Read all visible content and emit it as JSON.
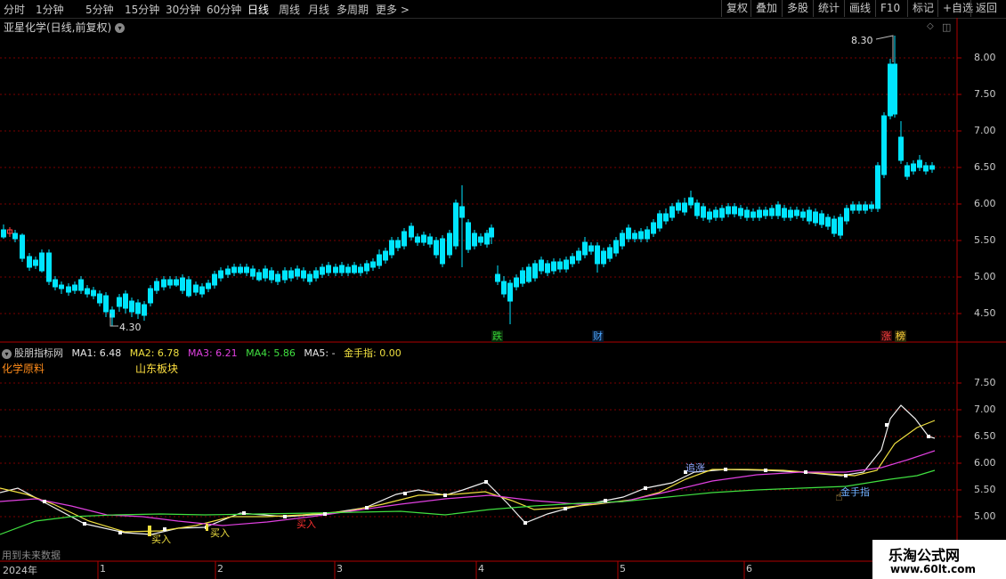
{
  "toolbar": {
    "timeframes": [
      "分时",
      "1分钟",
      "5分钟",
      "15分钟",
      "30分钟",
      "60分钟",
      "日线",
      "周线",
      "月线",
      "多周期",
      "更多 >"
    ],
    "active_timeframe": "日线",
    "buttons": [
      "复权",
      "叠加",
      "多股",
      "统计",
      "画线",
      "F10",
      "标记",
      "+自选",
      "返回"
    ]
  },
  "main_chart": {
    "title": "亚星化学(日线,前复权)",
    "high_label": "8.30",
    "low_label": "4.30",
    "y_ticks": [
      "8.00",
      "7.50",
      "7.00",
      "6.50",
      "6.00",
      "5.50",
      "5.00",
      "4.50"
    ],
    "events": [
      {
        "text": "跌",
        "color": "#35d135"
      },
      {
        "text": "财",
        "color": "#4aa6ff"
      },
      {
        "text": "涨",
        "color": "#ff4040"
      },
      {
        "text": "榜",
        "color": "#ffd23a"
      }
    ]
  },
  "indicator": {
    "name": "股朋指标网",
    "ma": [
      {
        "label": "MA1: 6.48",
        "color": "#e8e8e8"
      },
      {
        "label": "MA2: 6.78",
        "color": "#f0e040"
      },
      {
        "label": "MA3: 6.21",
        "color": "#e040e0"
      },
      {
        "label": "MA4: 5.86",
        "color": "#40e040"
      },
      {
        "label": "MA5: -",
        "color": "#e8e8e8"
      },
      {
        "label": "金手指: 0.00",
        "color": "#f0e040"
      }
    ],
    "sector_left": "化学原料",
    "sector_right": "山东板块",
    "y_ticks": [
      "7.50",
      "7.00",
      "6.50",
      "6.00",
      "5.50",
      "5.00"
    ],
    "signals": [
      {
        "text": "买入",
        "color": "#f0e040"
      },
      {
        "text": "买入",
        "color": "#f0e040"
      },
      {
        "text": "买入",
        "color": "#ff3030"
      },
      {
        "text": "追涨",
        "color": "#8fa8ff"
      },
      {
        "text": "金手指",
        "color": "#6fb0ff"
      }
    ],
    "footer_note": "用到未来数据"
  },
  "x_axis": {
    "labels": [
      "2024年",
      "1",
      "2",
      "3",
      "4",
      "5",
      "6"
    ]
  },
  "watermark": {
    "line1": "乐淘公式网",
    "line2": "www.60lt.com"
  },
  "colors": {
    "up": "#ff4040",
    "down": "#00e5ff",
    "grid": "#7a0000",
    "axis": "#b00000"
  }
}
